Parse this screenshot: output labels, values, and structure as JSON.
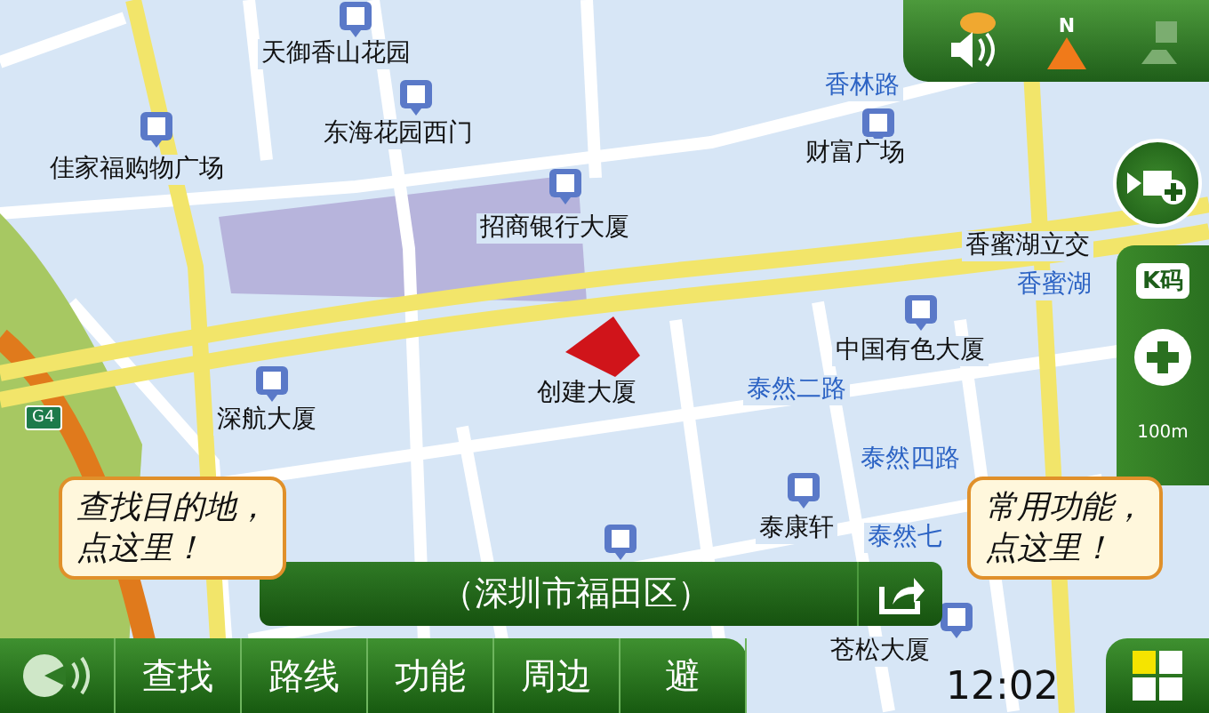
{
  "top_panel": {
    "compass_label": "N"
  },
  "map": {
    "places": [
      "天御香山花园",
      "东海花园西门",
      "佳家福购物广场",
      "招商银行大厦",
      "财富广场",
      "香蜜湖立交",
      "中国有色大厦",
      "创建大厦",
      "深航大厦",
      "泰康轩",
      "苍松大厦"
    ],
    "roads": [
      "香林路",
      "香蜜湖",
      "泰然二路",
      "泰然四路",
      "泰然七"
    ],
    "highway_sign": "G4"
  },
  "side_panel": {
    "k_code": "K码",
    "scale": "100m"
  },
  "tips": [
    {
      "lines": [
        "查找目的地，",
        "点这里！"
      ]
    },
    {
      "lines": [
        "常用功能，",
        "点这里！"
      ]
    }
  ],
  "location_bar": {
    "text": "（深圳市福田区）"
  },
  "bottom_bar": {
    "tabs": [
      "查找",
      "路线",
      "功能",
      "周边",
      "避"
    ],
    "time": "12:02"
  }
}
